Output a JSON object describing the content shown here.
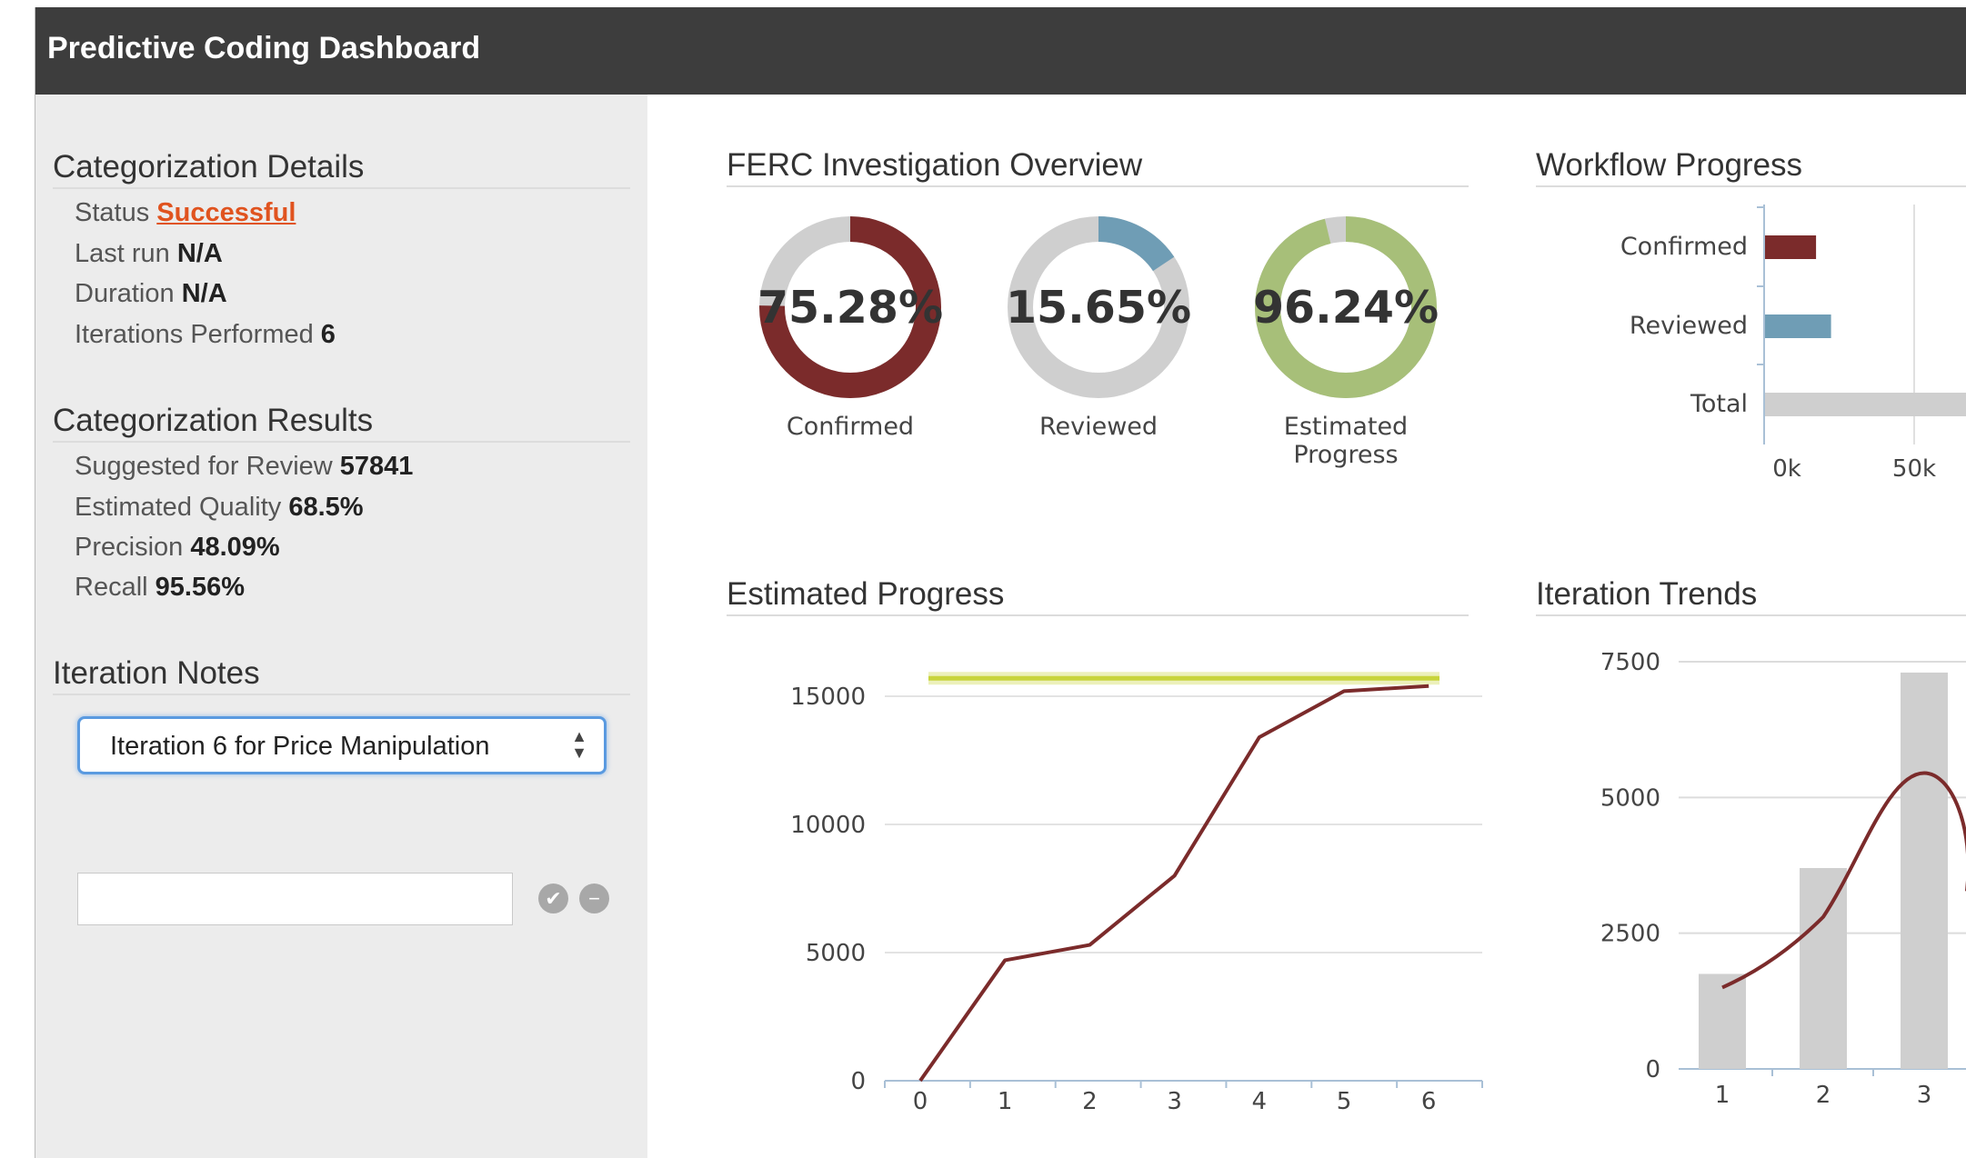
{
  "header": {
    "title": "Predictive Coding Dashboard"
  },
  "details": {
    "title": "Categorization Details",
    "status_label": "Status",
    "status_value": "Successful",
    "lastrun_label": "Last run",
    "lastrun_value": "N/A",
    "duration_label": "Duration",
    "duration_value": "N/A",
    "iterations_label": "Iterations Performed",
    "iterations_value": "6"
  },
  "results": {
    "title": "Categorization Results",
    "suggested_label": "Suggested for Review",
    "suggested_value": "57841",
    "quality_label": "Estimated Quality",
    "quality_value": "68.5%",
    "precision_label": "Precision",
    "precision_value": "48.09%",
    "recall_label": "Recall",
    "recall_value": "95.56%"
  },
  "notes": {
    "title": "Iteration Notes",
    "selected": "Iteration 6 for Price Manipulation",
    "input_value": ""
  },
  "overview": {
    "title": "FERC Investigation Overview",
    "donuts": [
      {
        "value_text": "75.28%",
        "fraction": 0.7528,
        "label": "Confirmed",
        "color": "#7b2b2b"
      },
      {
        "value_text": "15.65%",
        "fraction": 0.1565,
        "label": "Reviewed",
        "color": "#6f9db5"
      },
      {
        "value_text": "96.24%",
        "fraction": 0.9624,
        "label": "Estimated Progress",
        "color": "#a7bf79"
      }
    ],
    "track_color": "#cfcfcf"
  },
  "workflow": {
    "title": "Workflow Progress",
    "chart_data": {
      "type": "bar",
      "orientation": "horizontal",
      "categories": [
        "Confirmed",
        "Reviewed",
        "Total"
      ],
      "values": [
        17000,
        22000,
        80000
      ],
      "colors": [
        "#7b2b2b",
        "#6f9db5",
        "#cfcfcf"
      ],
      "x_ticks": [
        0,
        50000
      ],
      "x_tick_labels": [
        "0k",
        "50k"
      ],
      "xlim": [
        0,
        80000
      ]
    }
  },
  "estimated_progress": {
    "title": "Estimated Progress",
    "chart_data": {
      "type": "line",
      "x": [
        0,
        1,
        2,
        3,
        4,
        5,
        6
      ],
      "series": [
        {
          "values": [
            0,
            4700,
            5300,
            8000,
            13400,
            15200,
            15400
          ],
          "color": "#7b2b2b"
        }
      ],
      "target": {
        "value": 15700,
        "from": 0,
        "to": 6,
        "color": "#c8d43c"
      },
      "y_ticks": [
        0,
        5000,
        10000,
        15000
      ],
      "ylim": [
        0,
        15000
      ],
      "grid": true
    }
  },
  "iteration_trends": {
    "title": "Iteration Trends",
    "chart_data": {
      "type": "bar",
      "categories": [
        "1",
        "2",
        "3"
      ],
      "values": [
        1750,
        3700,
        7300
      ],
      "bar_color": "#cfcfcf",
      "trend_series": {
        "values": [
          1500,
          2800,
          5450
        ],
        "color": "#7b2b2b"
      },
      "y_ticks": [
        0,
        2500,
        5000,
        7500
      ],
      "ylim": [
        0,
        7500
      ],
      "grid": true
    }
  }
}
